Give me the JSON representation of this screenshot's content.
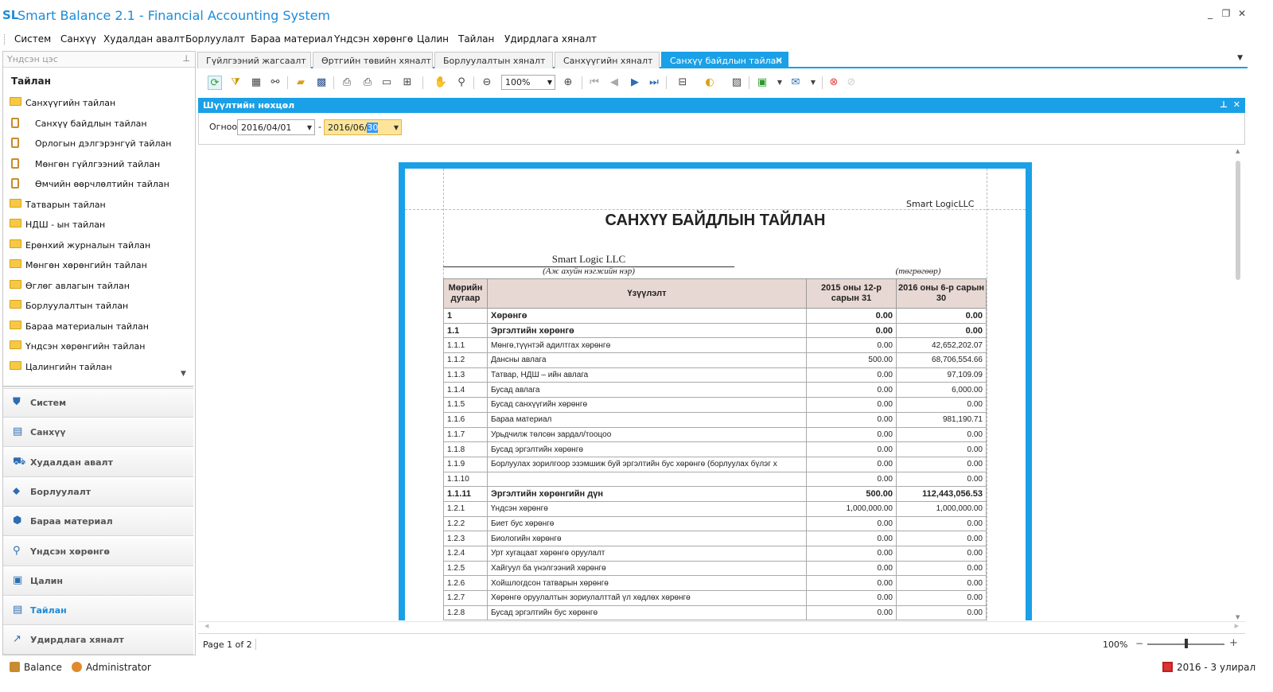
{
  "app": {
    "logo": "SL",
    "title": "Smart Balance 2.1 - Financial Accounting System"
  },
  "window": {
    "minimize": "_",
    "restore": "❐",
    "close": "✕"
  },
  "menu": [
    "Систем",
    "Санхүү",
    "Худалдан авалт",
    "Борлуулалт",
    "Бараа материал",
    "Үндсэн хөрөнгө",
    "Цалин",
    "Тайлан",
    "Удирдлага хяналт"
  ],
  "left_panel": {
    "search_placeholder": "Үндсэн цэс",
    "pin": "⊥",
    "header": "Тайлан",
    "tree": [
      {
        "label": "Санхүүгийн тайлан",
        "icon": "folder-icon",
        "level": 0
      },
      {
        "label": "Санхүү байдлын тайлан",
        "icon": "clipboard-icon",
        "level": 1
      },
      {
        "label": "Орлогын дэлгэрэнгүй тайлан",
        "icon": "clipboard-icon",
        "level": 1
      },
      {
        "label": "Мөнгөн гүйлгээний тайлан",
        "icon": "clipboard-icon",
        "level": 1
      },
      {
        "label": "Өмчийн өөрчлөлтийн тайлан",
        "icon": "clipboard-icon",
        "level": 1
      },
      {
        "label": "Татварын тайлан",
        "icon": "folder-icon",
        "level": 0
      },
      {
        "label": "НДШ - ын тайлан",
        "icon": "folder-icon",
        "level": 0
      },
      {
        "label": "Ерөнхий журналын тайлан",
        "icon": "folder-icon",
        "level": 0
      },
      {
        "label": "Мөнгөн хөрөнгийн тайлан",
        "icon": "folder-icon",
        "level": 0
      },
      {
        "label": "Өглөг авлагын тайлан",
        "icon": "folder-icon",
        "level": 0
      },
      {
        "label": "Борлуулалтын тайлан",
        "icon": "folder-icon",
        "level": 0
      },
      {
        "label": "Бараа материалын тайлан",
        "icon": "folder-icon",
        "level": 0
      },
      {
        "label": "Үндсэн хөрөнгийн тайлан",
        "icon": "folder-icon",
        "level": 0
      },
      {
        "label": "Цалингийн тайлан",
        "icon": "folder-icon",
        "level": 0
      }
    ],
    "nav": [
      {
        "label": "Систем",
        "icon": "shield-icon",
        "glyph": "⛊",
        "active": false
      },
      {
        "label": "Санхүү",
        "icon": "clipboard-icon",
        "glyph": "▤",
        "active": false
      },
      {
        "label": "Худалдан авалт",
        "icon": "cart-icon",
        "glyph": "⛟",
        "active": false
      },
      {
        "label": "Борлуулалт",
        "icon": "tag-icon",
        "glyph": "⬥",
        "active": false
      },
      {
        "label": "Бараа материал",
        "icon": "boxes-icon",
        "glyph": "⬢",
        "active": false
      },
      {
        "label": "Үндсэн хөрөнгө",
        "icon": "microphone-icon",
        "glyph": "⚲",
        "active": false
      },
      {
        "label": "Цалин",
        "icon": "money-icon",
        "glyph": "▣",
        "active": false
      },
      {
        "label": "Тайлан",
        "icon": "report-icon",
        "glyph": "▤",
        "active": true
      },
      {
        "label": "Удирдлага хяналт",
        "icon": "chart-icon",
        "glyph": "↗",
        "active": false
      }
    ]
  },
  "tabs": [
    {
      "label": "Гүйлгээний жагсаалт",
      "active": false
    },
    {
      "label": "Өртгийн төвийн хяналт",
      "active": false
    },
    {
      "label": "Борлуулалтын хяналт",
      "active": false
    },
    {
      "label": "Санхүүгийн хяналт",
      "active": false
    },
    {
      "label": "Санхүү байдлын тайлан",
      "active": true
    }
  ],
  "toolbar": {
    "zoom": "100%"
  },
  "filter": {
    "title": "Шүүлтийн нөхцөл",
    "date_label": "Огноо",
    "date_from": "2016/04/01",
    "date_to_prefix": "2016/06/",
    "date_to_selected": "30",
    "separator": "-"
  },
  "report": {
    "company_top": "Smart LogicLLC",
    "title": "САНХҮҮ БАЙДЛЫН ТАЙЛАН",
    "org_name": "Smart Logic LLC",
    "org_caption": "(Аж ахуйн нэгжийн нэр)",
    "unit": "(төгрөгөөр)",
    "headers": [
      "Мөрийн дугаар",
      "Үзүүлэлт",
      "2015 оны 12-р сарын 31",
      "2016 оны 6-р сарын 30"
    ],
    "rows": [
      {
        "no": "1",
        "name": "Хөрөнгө",
        "v1": "0.00",
        "v2": "0.00",
        "bold": true
      },
      {
        "no": "1.1",
        "name": "Эргэлтийн хөрөнгө",
        "v1": "0.00",
        "v2": "0.00",
        "bold": true
      },
      {
        "no": "1.1.1",
        "name": "Мөнгө,түүнтэй адилтгах хөрөнгө",
        "v1": "0.00",
        "v2": "42,652,202.07",
        "bold": false
      },
      {
        "no": "1.1.2",
        "name": "Дансны авлага",
        "v1": "500.00",
        "v2": "68,706,554.66",
        "bold": false
      },
      {
        "no": "1.1.3",
        "name": "Татвар, НДШ – ийн авлага",
        "v1": "0.00",
        "v2": "97,109.09",
        "bold": false
      },
      {
        "no": "1.1.4",
        "name": "Бусад авлага",
        "v1": "0.00",
        "v2": "6,000.00",
        "bold": false
      },
      {
        "no": "1.1.5",
        "name": "Бусад санхүүгийн хөрөнгө",
        "v1": "0.00",
        "v2": "0.00",
        "bold": false
      },
      {
        "no": "1.1.6",
        "name": "Бараа материал",
        "v1": "0.00",
        "v2": "981,190.71",
        "bold": false
      },
      {
        "no": "1.1.7",
        "name": "Урьдчилж төлсөн зардал/тооцоо",
        "v1": "0.00",
        "v2": "0.00",
        "bold": false
      },
      {
        "no": "1.1.8",
        "name": "Бусад эргэлтийн хөрөнгө",
        "v1": "0.00",
        "v2": "0.00",
        "bold": false
      },
      {
        "no": "1.1.9",
        "name": "Борлуулах зорилгоор эзэмшиж буй эргэлтийн бус хөрөнгө (борлуулах бүлэг х",
        "v1": "0.00",
        "v2": "0.00",
        "bold": false
      },
      {
        "no": "1.1.10",
        "name": "",
        "v1": "0.00",
        "v2": "0.00",
        "bold": false
      },
      {
        "no": "1.1.11",
        "name": "Эргэлтийн хөрөнгийн дүн",
        "v1": "500.00",
        "v2": "112,443,056.53",
        "bold": true
      },
      {
        "no": "1.2.1",
        "name": "Үндсэн хөрөнгө",
        "v1": "1,000,000.00",
        "v2": "1,000,000.00",
        "bold": false
      },
      {
        "no": "1.2.2",
        "name": "Биет бус хөрөнгө",
        "v1": "0.00",
        "v2": "0.00",
        "bold": false
      },
      {
        "no": "1.2.3",
        "name": "Биологийн хөрөнгө",
        "v1": "0.00",
        "v2": "0.00",
        "bold": false
      },
      {
        "no": "1.2.4",
        "name": "Урт хугацаат хөрөнгө оруулалт",
        "v1": "0.00",
        "v2": "0.00",
        "bold": false
      },
      {
        "no": "1.2.5",
        "name": "Хайгуул ба үнэлгээний хөрөнгө",
        "v1": "0.00",
        "v2": "0.00",
        "bold": false
      },
      {
        "no": "1.2.6",
        "name": "Хойшлогдсон татварын хөрөнгө",
        "v1": "0.00",
        "v2": "0.00",
        "bold": false
      },
      {
        "no": "1.2.7",
        "name": "Хөрөнгө оруулалтын зориулалттай үл хөдлөх хөрөнгө",
        "v1": "0.00",
        "v2": "0.00",
        "bold": false
      },
      {
        "no": "1.2.8",
        "name": "Бусад эргэлтийн бус хөрөнгө",
        "v1": "0.00",
        "v2": "0.00",
        "bold": false
      }
    ]
  },
  "pager": {
    "page_info": "Page 1 of 2",
    "zoom": "100%",
    "zoom_level_percent": 50
  },
  "status": {
    "app": "Balance",
    "user": "Administrator",
    "period": "2016 - 3 улирал"
  }
}
